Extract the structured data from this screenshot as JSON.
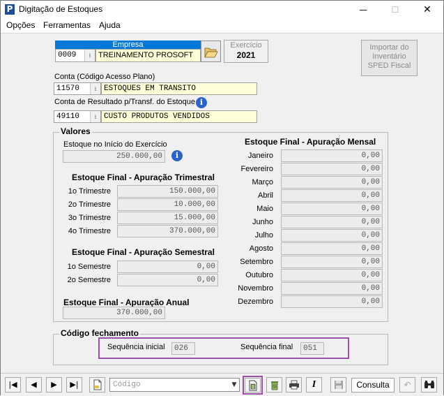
{
  "window": {
    "title": "Digitação de Estoques",
    "minimize": "—",
    "maximize": "☐",
    "close": "✕"
  },
  "menu": [
    "Opções",
    "Ferramentas",
    "Ajuda"
  ],
  "empresa": {
    "header": "Empresa",
    "code": "0009",
    "name": "TREINAMENTO PROSOFT"
  },
  "exercicio": {
    "label": "Exercício",
    "value": "2021"
  },
  "import_button": {
    "label_line1": "Importar do",
    "label_line2": "Inventário",
    "label_line3": "SPED Fiscal"
  },
  "conta": {
    "label": "Conta (Código Acesso Plano)",
    "code": "11570",
    "name": "ESTOQUES EM TRANSITO"
  },
  "conta_resultado": {
    "label": "Conta de Resultado p/Transf. do Estoque",
    "code": "49110",
    "name": "CUSTO PRODUTOS VENDIDOS"
  },
  "valores": {
    "legend": "Valores",
    "inicio_label": "Estoque no Início do Exercício",
    "inicio_value": "250.000,00",
    "trimestral": {
      "title": "Estoque Final - Apuração Trimestral",
      "rows": [
        {
          "label": "1o Trimestre",
          "value": "150.000,00"
        },
        {
          "label": "2o Trimestre",
          "value": "10.000,00"
        },
        {
          "label": "3o Trimestre",
          "value": "15.000,00"
        },
        {
          "label": "4o Trimestre",
          "value": "370.000,00"
        }
      ]
    },
    "semestral": {
      "title": "Estoque Final - Apuração Semestral",
      "rows": [
        {
          "label": "1o Semestre",
          "value": "0,00"
        },
        {
          "label": "2o Semestre",
          "value": "0,00"
        }
      ]
    },
    "anual": {
      "title": "Estoque Final - Apuração Anual",
      "value": "370.000,00"
    },
    "mensal": {
      "title": "Estoque Final - Apuração Mensal",
      "rows": [
        {
          "label": "Janeiro",
          "value": "0,00"
        },
        {
          "label": "Fevereiro",
          "value": "0,00"
        },
        {
          "label": "Março",
          "value": "0,00"
        },
        {
          "label": "Abril",
          "value": "0,00"
        },
        {
          "label": "Maio",
          "value": "0,00"
        },
        {
          "label": "Junho",
          "value": "0,00"
        },
        {
          "label": "Julho",
          "value": "0,00"
        },
        {
          "label": "Agosto",
          "value": "0,00"
        },
        {
          "label": "Setembro",
          "value": "0,00"
        },
        {
          "label": "Outubro",
          "value": "0,00"
        },
        {
          "label": "Novembro",
          "value": "0,00"
        },
        {
          "label": "Dezembro",
          "value": "0,00"
        }
      ]
    }
  },
  "fechamento": {
    "legend": "Código fechamento",
    "seq_inicial_label": "Sequência inicial",
    "seq_inicial": "026",
    "seq_final_label": "Sequência final",
    "seq_final": "051"
  },
  "toolbar": {
    "first": "|◀",
    "prev": "◀",
    "next": "▶",
    "last": "▶|",
    "search_placeholder": "Código",
    "consulta": "Consulta",
    "italic": "I"
  },
  "colors": {
    "highlight": "#9b4fa8",
    "accent": "#0078d7",
    "readonly_bg": "#ffffd8"
  }
}
